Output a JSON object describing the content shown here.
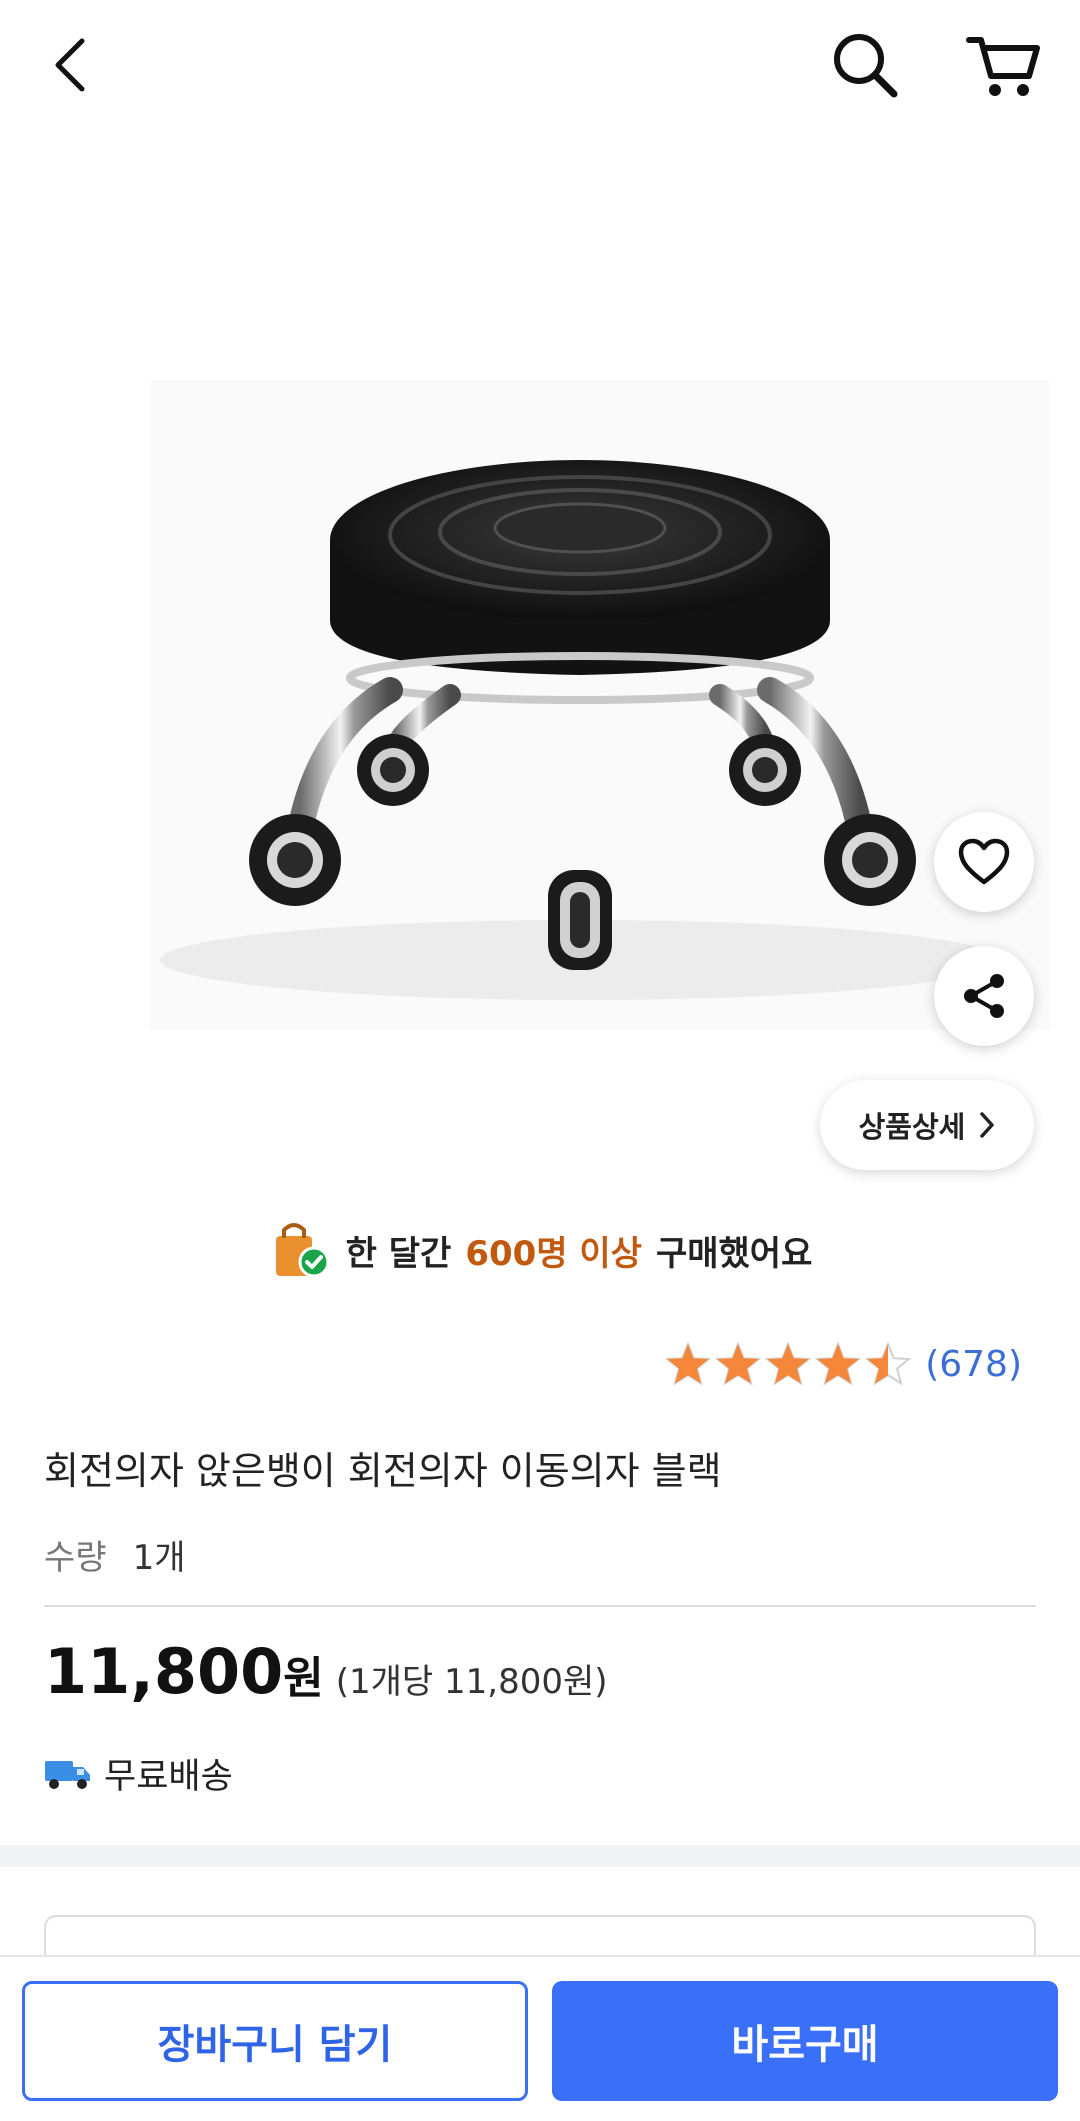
{
  "header": {
    "back_icon": "chevron-left-icon",
    "search_icon": "search-icon",
    "cart_icon": "cart-icon"
  },
  "product": {
    "image_subject": "low round swivel stool with wheels",
    "detail_button_label": "상품상세",
    "social_proof": {
      "prefix": "한 달간",
      "highlight": "600명 이상",
      "suffix": "구매했어요",
      "highlight_color": "#c2590f"
    },
    "rating": {
      "stars": 4.5,
      "count": "(678)"
    },
    "title": "회전의자 앉은뱅이 회전의자 이동의자 블랙",
    "quantity_label": "수량",
    "quantity_value": "1개",
    "price": "11,800",
    "price_currency": "원",
    "unit_price": "(1개당 11,800원)",
    "shipping": "무료배송"
  },
  "actions": {
    "add_to_cart": "장바구니 담기",
    "buy_now": "바로구매"
  },
  "colors": {
    "accent": "#3a6ff7",
    "star": "#f4873a",
    "rating_count": "#3c6fd6"
  }
}
